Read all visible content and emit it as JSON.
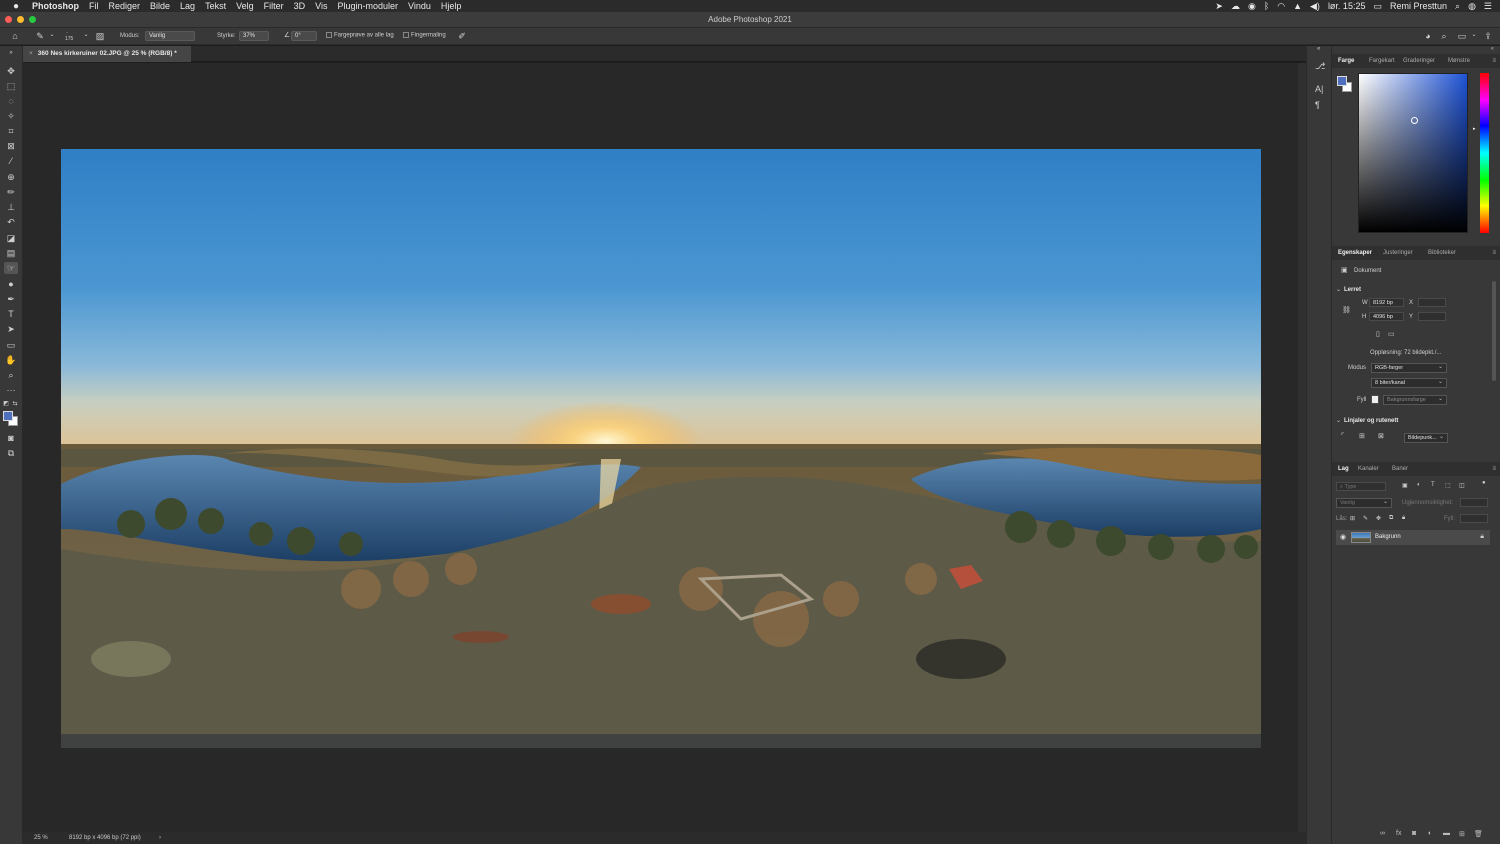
{
  "menubar": {
    "apple": "",
    "app": "Photoshop",
    "items": [
      "Fil",
      "Rediger",
      "Bilde",
      "Lag",
      "Tekst",
      "Velg",
      "Filter",
      "3D",
      "Vis",
      "Plugin-moduler",
      "Vindu",
      "Hjelp"
    ],
    "clock": "lør. 15:25",
    "user": "Remi Presttun"
  },
  "window": {
    "title": "Adobe Photoshop 2021"
  },
  "options": {
    "brush_size": "175",
    "mode_label": "Modus:",
    "mode_value": "Vanlig",
    "strength_label": "Styrke:",
    "strength_value": "37%",
    "angle_value": "0°",
    "sample_all_label": "Fargeprøve av alle lag",
    "finger_label": "Fingermaling"
  },
  "document": {
    "tab_label": "360 Nes kirkeruiner 02.JPG @ 25 % (RGB/8) *",
    "close": "×"
  },
  "status": {
    "zoom": "25 %",
    "info": "8192 bp x 4096 bp (72 ppi)",
    "arrow": "›"
  },
  "color_panel": {
    "tabs": [
      "Farge",
      "Fargekart",
      "Graderinger",
      "Mønstre"
    ],
    "foreground": "#4f6fbf",
    "background": "#ffffff"
  },
  "properties_panel": {
    "tabs": [
      "Egenskaper",
      "Justeringer",
      "Biblioteker"
    ],
    "doc_label": "Dokument",
    "canvas_section": "Lerret",
    "w_label": "W",
    "w_value": "8192 bp",
    "h_label": "H",
    "h_value": "4096 bp",
    "x_label": "X",
    "y_label": "Y",
    "resolution": "Oppløsning: 72 bildepkt./...",
    "mode_label": "Modus",
    "mode_value": "RGB-farger",
    "depth_value": "8 biter/kanal",
    "fill_label": "Fyll",
    "fill_value": "Bakgrunnsfarge",
    "rulers_section": "Linjaler og rutenett",
    "units_value": "Bildepunk..."
  },
  "layers_panel": {
    "tabs": [
      "Lag",
      "Kanaler",
      "Baner"
    ],
    "search_placeholder": "Type",
    "blend_mode": "Vanlig",
    "opacity_label": "Ugjennomsiktighet:",
    "lock_label": "Lås:",
    "fill_label": "Fyll:",
    "layer_name": "Bakgrunn"
  }
}
